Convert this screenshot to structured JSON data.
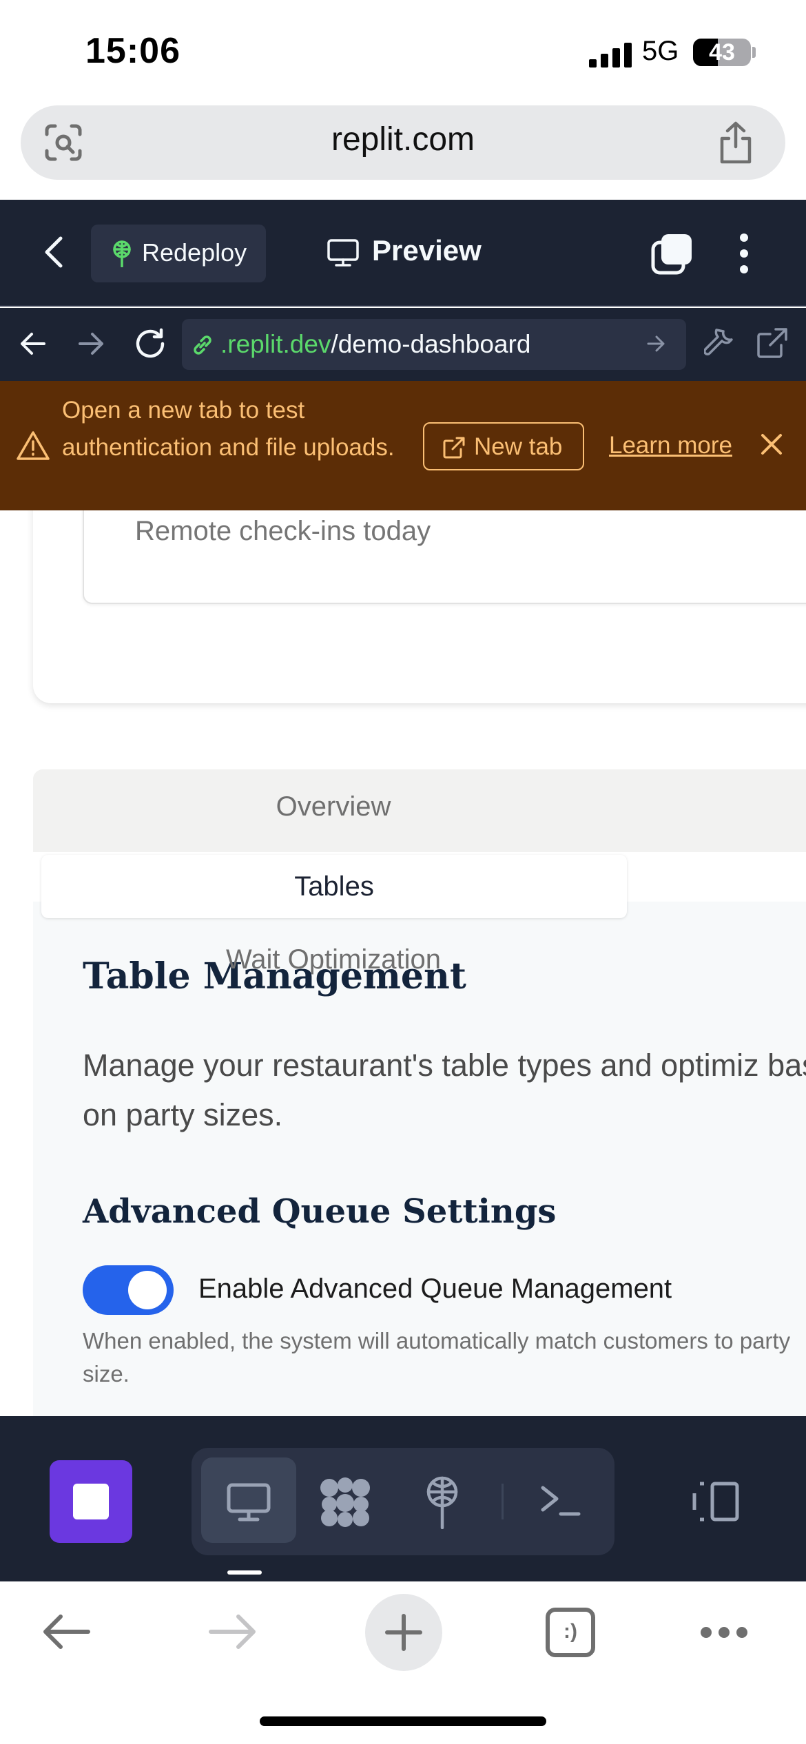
{
  "status_bar": {
    "time": "15:06",
    "network": "5G",
    "battery": "43",
    "battery_level": 0.43
  },
  "browser": {
    "url": "replit.com"
  },
  "replit_header": {
    "redeploy_label": "Redeploy",
    "preview_label": "Preview"
  },
  "webview": {
    "url_domain": ".replit.dev",
    "url_path": "/demo-dashboard"
  },
  "banner": {
    "message": "Open a new tab to test authentication and file uploads.",
    "new_tab_label": "New tab",
    "learn_more_label": "Learn more"
  },
  "app": {
    "card_label": "Remote check-ins today",
    "tabs": [
      {
        "label": "Overview"
      },
      {
        "label": "Tables"
      },
      {
        "label": "Wait Optimization"
      }
    ],
    "section_title": "Table Management",
    "section_description": "Manage your restaurant's table types and optimiz based on party sizes.",
    "settings_title": "Advanced Queue Settings",
    "toggle_label": "Enable Advanced Queue Management",
    "toggle_on": true,
    "toggle_help": "When enabled, the system will automatically match customers to party size."
  },
  "safari_bottom": {
    "tabs_glyph": ":)"
  },
  "colors": {
    "replit_bg": "#1c2333",
    "banner_bg": "#5c2d06",
    "banner_text": "#fbbf74",
    "accent_green": "#5bd96b",
    "toggle_blue": "#2563eb",
    "stop_purple": "#6b38e0"
  },
  "icons": {
    "lens": "camera-lens-icon",
    "share": "share-icon",
    "back": "chevron-left-icon",
    "preview": "monitor-icon",
    "tabs": "stacked-tabs-icon",
    "menu": "kebab-icon",
    "warning": "warning-icon",
    "close": "close-icon"
  }
}
